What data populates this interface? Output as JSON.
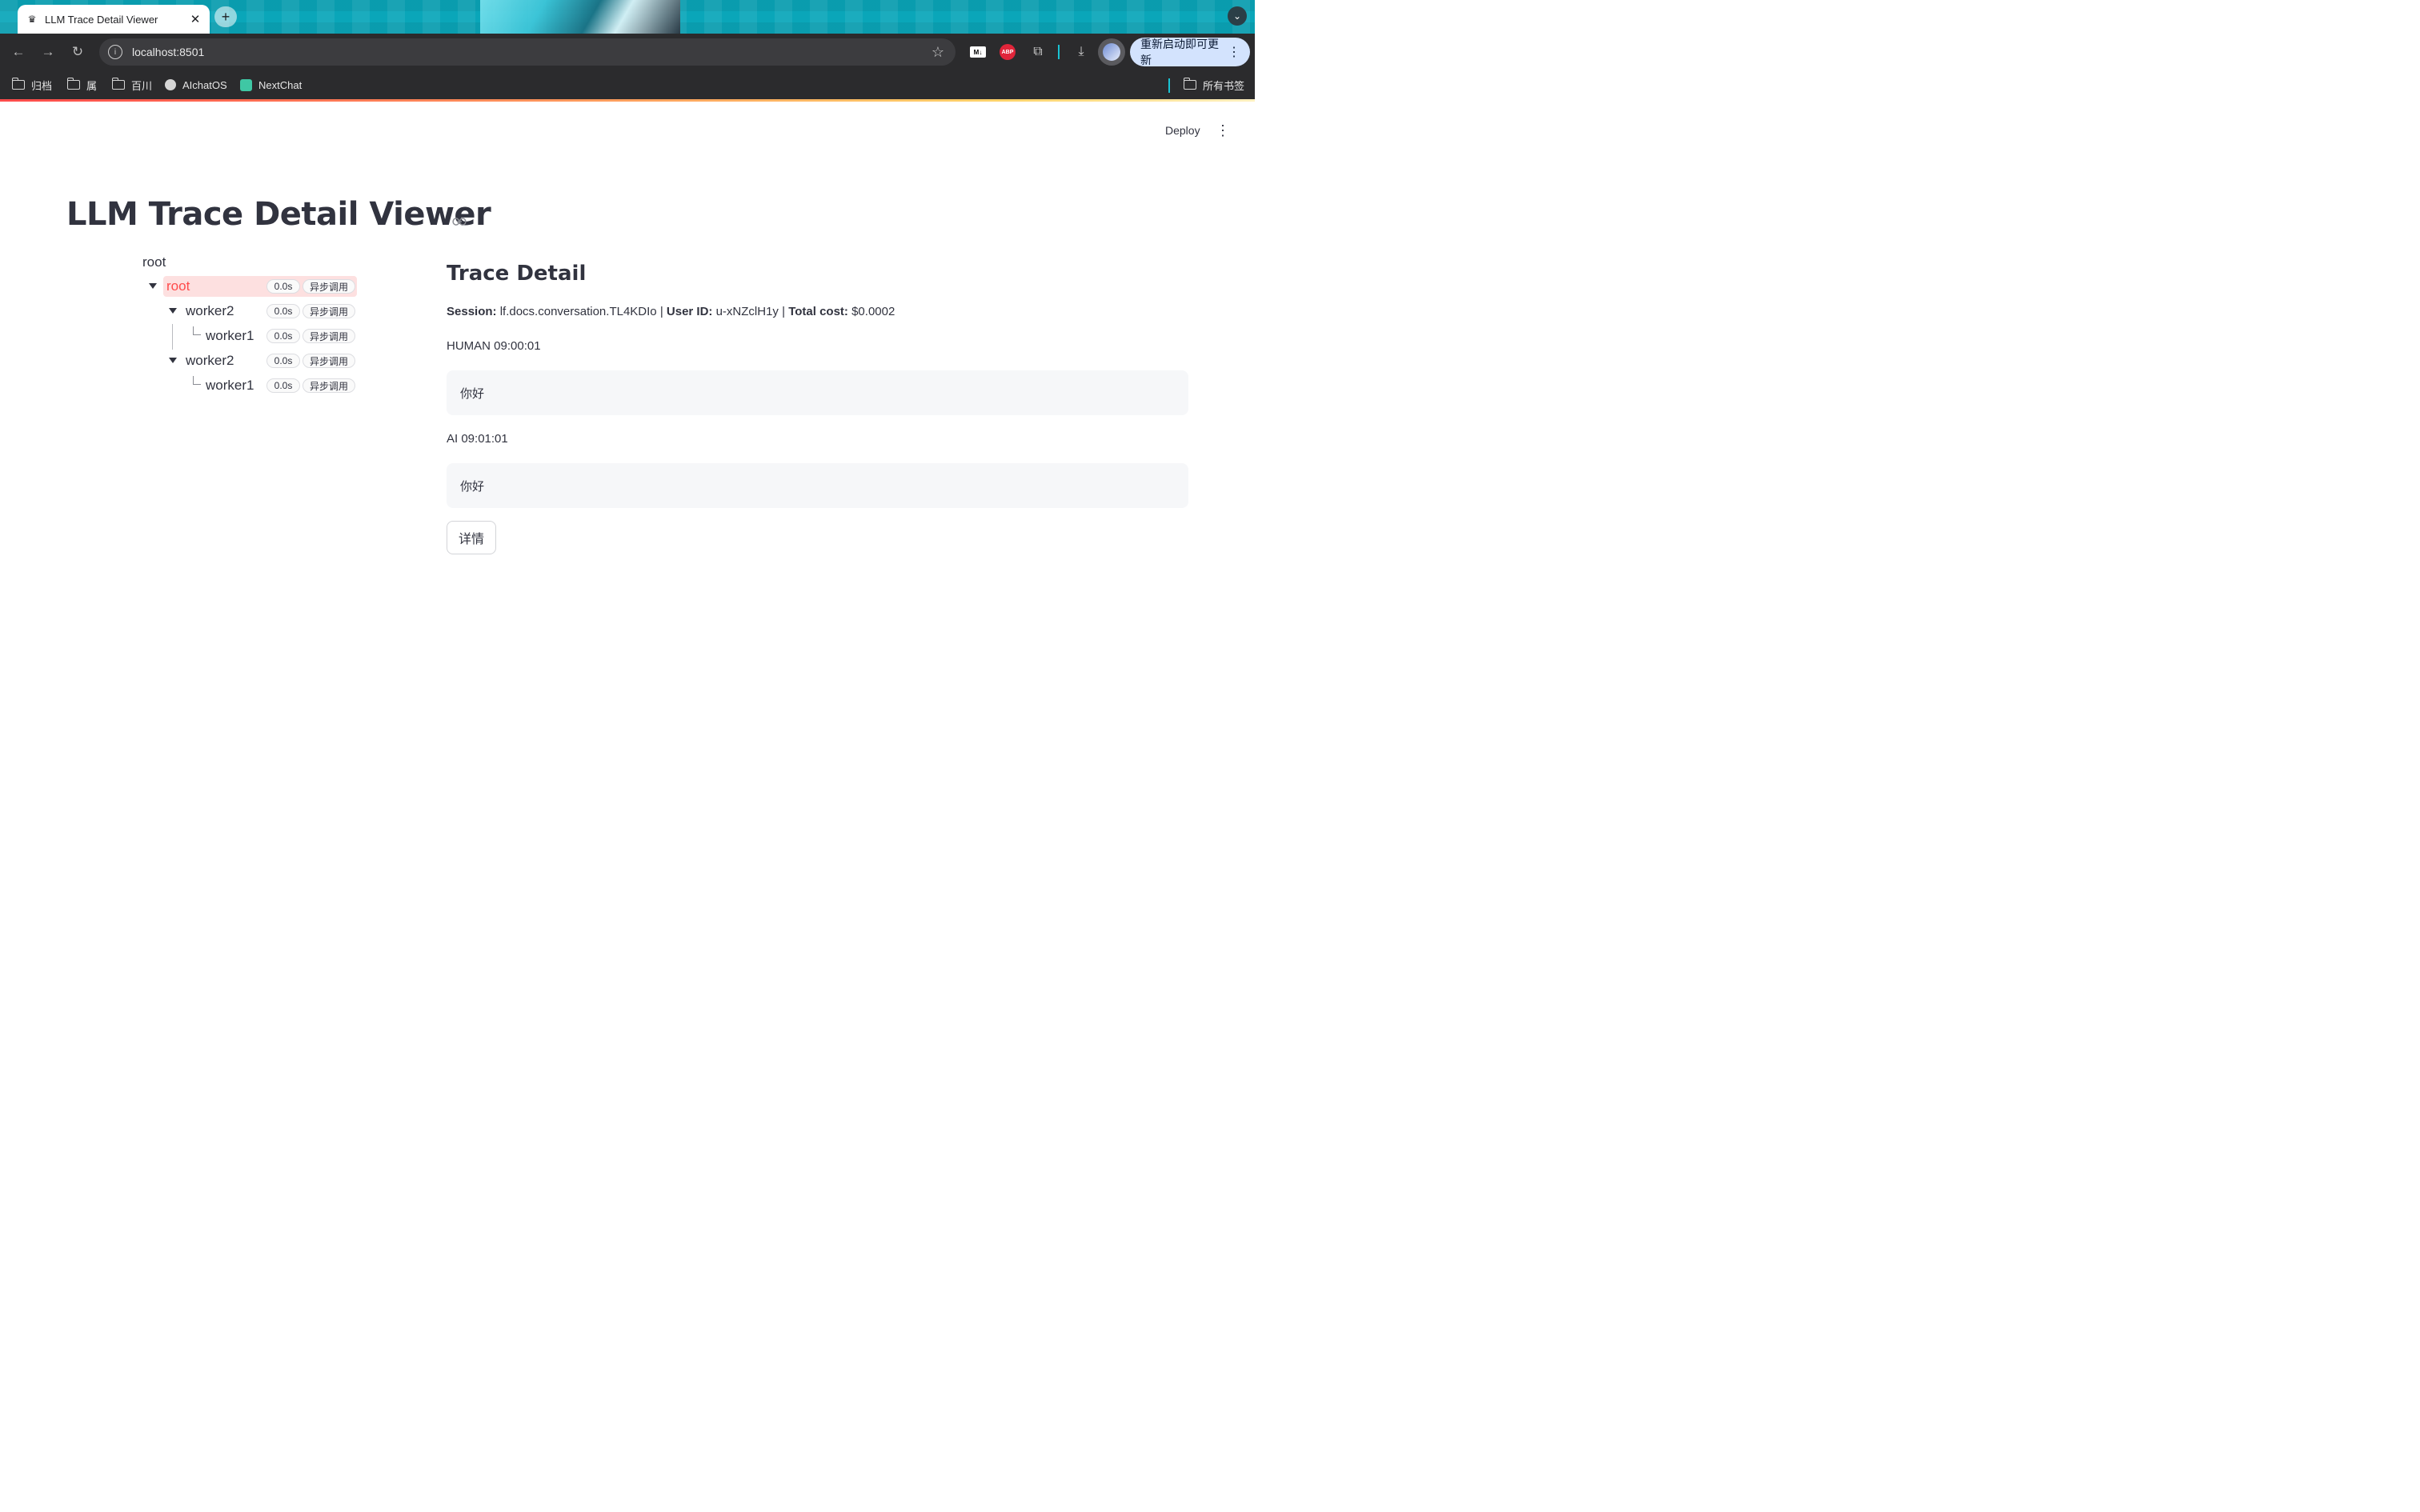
{
  "browser": {
    "tab_title": "LLM Trace Detail Viewer",
    "new_tab_symbol": "+",
    "close_symbol": "✕",
    "url": "localhost:8501",
    "update_button_label": "重新启动即可更新",
    "extensions": {
      "markdown": "M↓",
      "adblock": "ABP"
    },
    "bookmarks": [
      {
        "label": "归档",
        "icon": "folder-icon"
      },
      {
        "label": "属",
        "icon": "folder-icon"
      },
      {
        "label": "百川",
        "icon": "folder-icon"
      },
      {
        "label": "AIchatOS",
        "icon": "globe-icon"
      },
      {
        "label": "NextChat",
        "icon": "nextchat-icon"
      }
    ],
    "all_bookmarks_label": "所有书签"
  },
  "app": {
    "deploy_label": "Deploy",
    "title": "LLM Trace Detail Viewer",
    "tree": {
      "header": "root",
      "nodes": [
        {
          "label": "root",
          "duration": "0.0s",
          "tag": "异步调用",
          "selected": true,
          "expanded": true
        },
        {
          "label": "worker2",
          "duration": "0.0s",
          "tag": "异步调用",
          "expanded": true
        },
        {
          "label": "worker1",
          "duration": "0.0s",
          "tag": "异步调用"
        },
        {
          "label": "worker2",
          "duration": "0.0s",
          "tag": "异步调用",
          "expanded": true
        },
        {
          "label": "worker1",
          "duration": "0.0s",
          "tag": "异步调用"
        }
      ]
    },
    "detail": {
      "title": "Trace Detail",
      "session_label": "Session:",
      "session_value": "lf.docs.conversation.TL4KDIo",
      "user_label": "User ID:",
      "user_value": "u-xNZclH1y",
      "cost_label": "Total cost:",
      "cost_value": "$0.0002",
      "separator": "|",
      "messages": [
        {
          "header": "HUMAN 09:00:01",
          "content": "你好"
        },
        {
          "header": "AI 09:01:01",
          "content": "你好"
        }
      ],
      "details_button": "详情"
    }
  },
  "colors": {
    "accent": "#ff4b4b",
    "selected_bg": "#fde0e0",
    "tab_strip": "#0aa6b9",
    "toolbar": "#2b2b2d"
  }
}
